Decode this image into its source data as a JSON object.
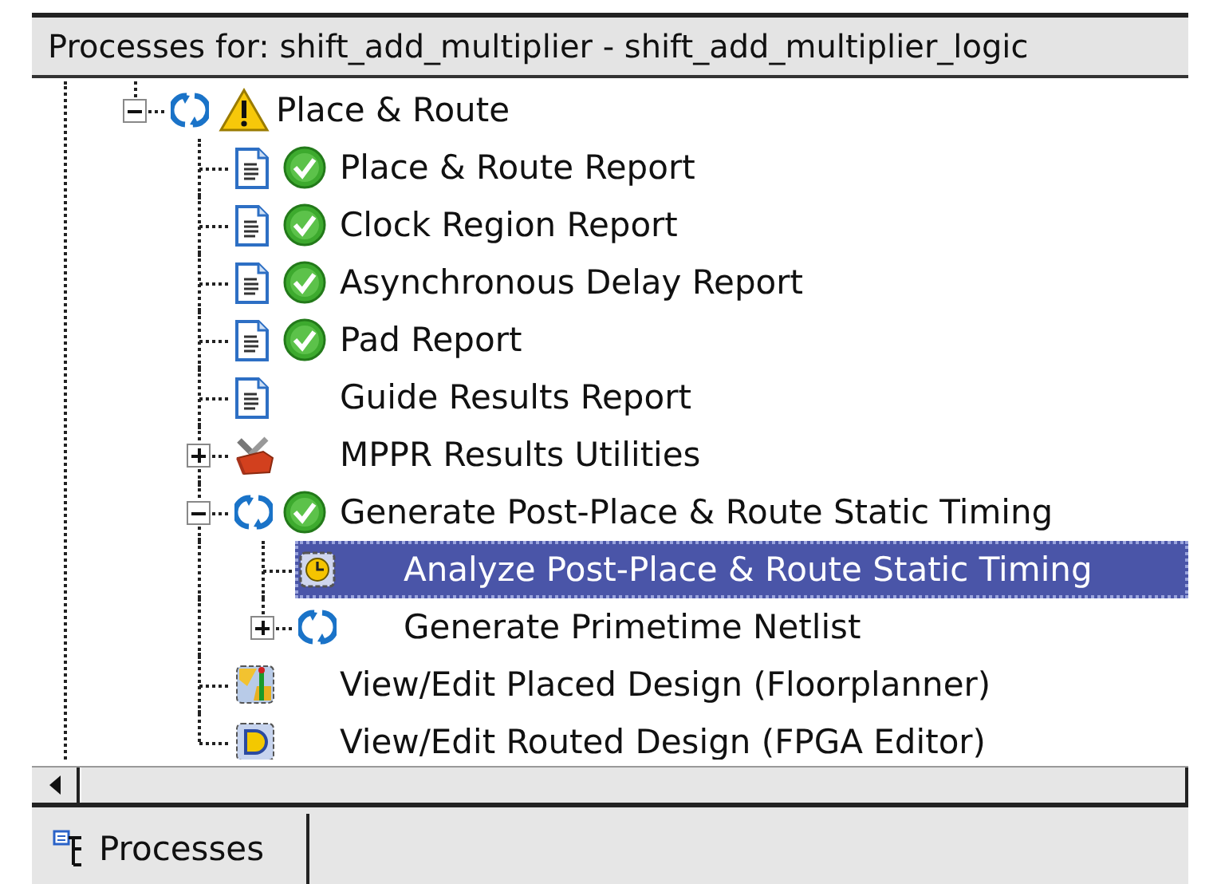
{
  "title": "Processes for: shift_add_multiplier - shift_add_multiplier_logic",
  "tree": [
    {
      "label": "Place & Route",
      "kind": "refresh",
      "warning": true,
      "done": false,
      "expanded": true,
      "selected": false,
      "children": [
        {
          "label": "Place & Route Report",
          "kind": "report",
          "warning": false,
          "done": true,
          "selected": false
        },
        {
          "label": "Clock Region Report",
          "kind": "report",
          "warning": false,
          "done": true,
          "selected": false
        },
        {
          "label": "Asynchronous Delay Report",
          "kind": "report",
          "warning": false,
          "done": true,
          "selected": false
        },
        {
          "label": "Pad Report",
          "kind": "report",
          "warning": false,
          "done": true,
          "selected": false
        },
        {
          "label": "Guide Results Report",
          "kind": "report",
          "warning": false,
          "done": false,
          "selected": false
        },
        {
          "label": "MPPR Results Utilities",
          "kind": "tools",
          "warning": false,
          "done": false,
          "expanded": false,
          "selected": false
        },
        {
          "label": "Generate Post-Place & Route Static Timing",
          "kind": "refresh",
          "warning": false,
          "done": true,
          "expanded": true,
          "selected": false,
          "children": [
            {
              "label": "Analyze Post-Place & Route Static Timing",
              "kind": "clock",
              "warning": false,
              "done": false,
              "selected": true
            },
            {
              "label": "Generate Primetime Netlist",
              "kind": "refresh",
              "warning": false,
              "done": false,
              "expanded": false,
              "selected": false
            }
          ]
        },
        {
          "label": "View/Edit Placed Design (Floorplanner)",
          "kind": "floorplan",
          "warning": false,
          "done": false,
          "selected": false
        },
        {
          "label": "View/Edit Routed Design (FPGA Editor)",
          "kind": "editor",
          "warning": false,
          "done": false,
          "selected": false
        }
      ]
    }
  ],
  "tabs": [
    {
      "label": "Processes",
      "selected": true
    }
  ]
}
